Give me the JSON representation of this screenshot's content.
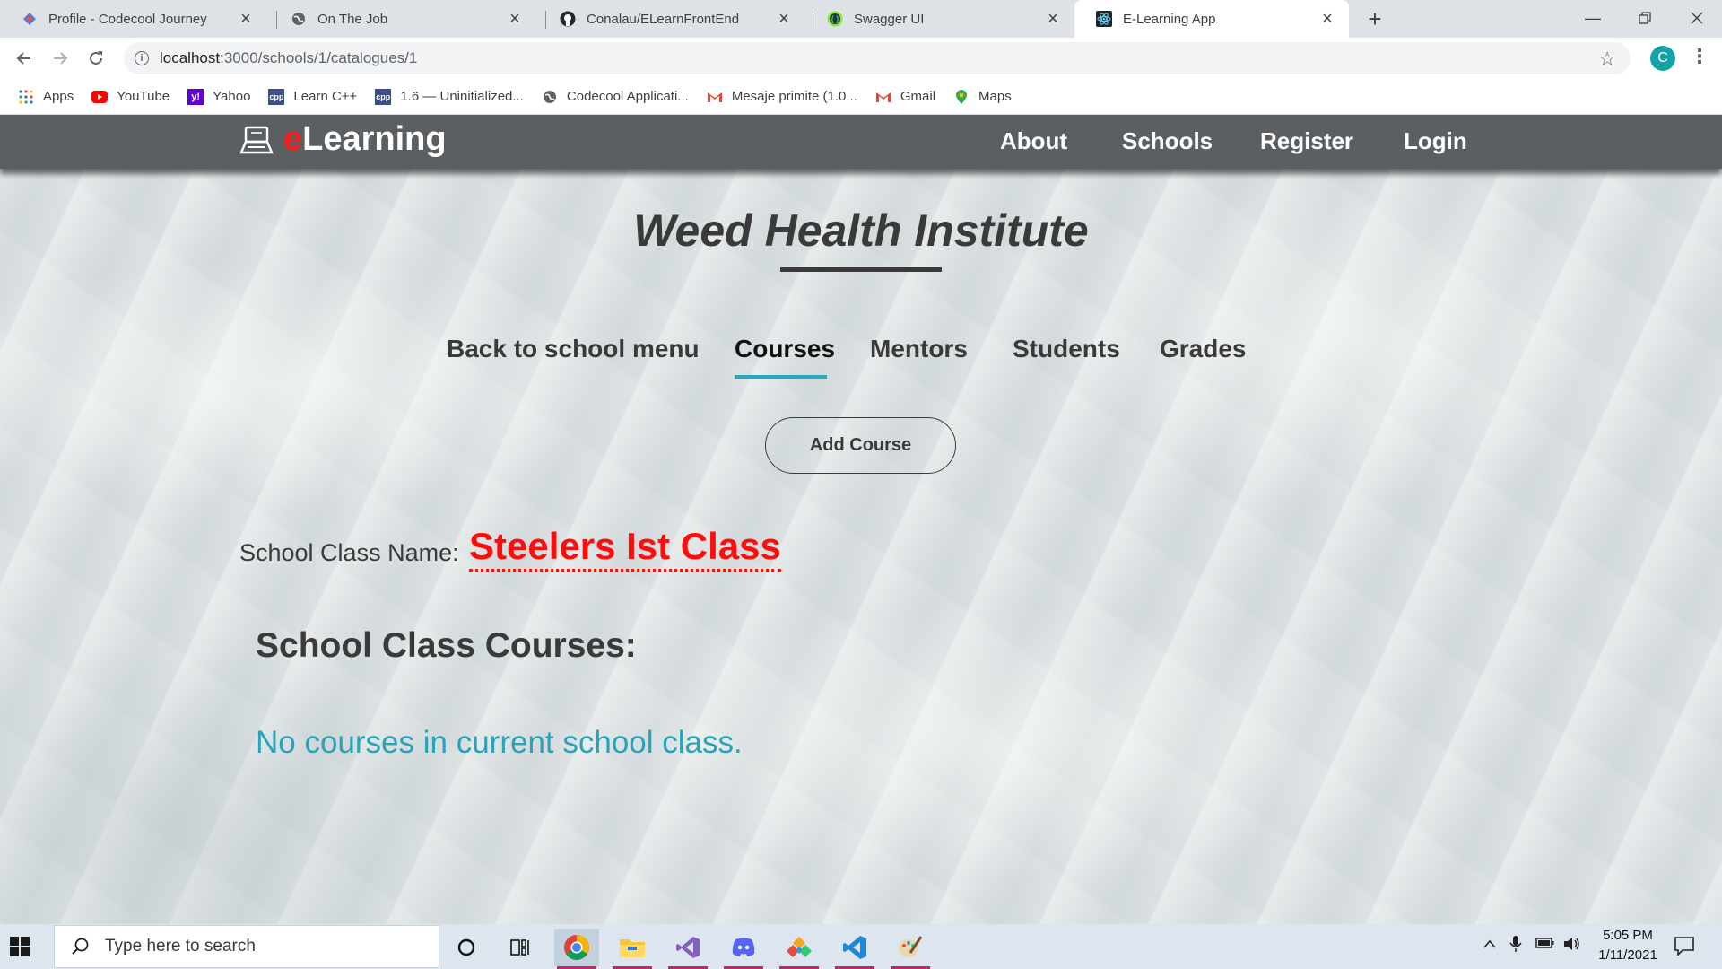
{
  "browser": {
    "tabs": [
      {
        "title": "Profile - Codecool Journey",
        "icon": "codecool-diamond-icon"
      },
      {
        "title": "On The Job",
        "icon": "globe-icon"
      },
      {
        "title": "Conalau/ELearnFrontEnd",
        "icon": "github-icon"
      },
      {
        "title": "Swagger UI",
        "icon": "swagger-icon"
      },
      {
        "title": "E-Learning App",
        "icon": "react-icon",
        "active": true
      }
    ],
    "url_host": "localhost",
    "url_path": ":3000/schools/1/catalogues/1",
    "profile_initial": "C",
    "bookmarks": [
      {
        "label": "Apps",
        "icon": "apps-grid-icon"
      },
      {
        "label": "YouTube",
        "icon": "youtube-icon"
      },
      {
        "label": "Yahoo",
        "icon": "yahoo-icon"
      },
      {
        "label": "Learn C++",
        "icon": "cpp-icon"
      },
      {
        "label": "1.6 — Uninitialized...",
        "icon": "cpp-icon"
      },
      {
        "label": "Codecool Applicati...",
        "icon": "globe-icon"
      },
      {
        "label": "Mesaje primite (1.0...",
        "icon": "gmail-icon"
      },
      {
        "label": "Gmail",
        "icon": "gmail-icon"
      },
      {
        "label": "Maps",
        "icon": "maps-icon"
      }
    ]
  },
  "site": {
    "brand_e": "e",
    "brand_rest": "Learning",
    "nav": [
      "About",
      "Schools",
      "Register",
      "Login"
    ],
    "school_title": "Weed Health Institute",
    "subnav": [
      "Back to school menu",
      "Courses",
      "Mentors",
      "Students",
      "Grades"
    ],
    "active_subnav": "Courses",
    "add_course_label": "Add Course",
    "class_label": "School Class Name:",
    "class_name": "Steelers Ist Class",
    "courses_heading": "School Class Courses:",
    "no_courses_text": "No courses in current school class."
  },
  "taskbar": {
    "search_placeholder": "Type here to search",
    "time": "5:05 PM",
    "date": "1/11/2021"
  },
  "colors": {
    "nav_bg": "#5c5f61",
    "brand_accent": "#ff1a1a",
    "class_name": "#ff0d0d",
    "active_tab_bar": "#2aa7c0",
    "info_text": "#2aa2b8"
  }
}
